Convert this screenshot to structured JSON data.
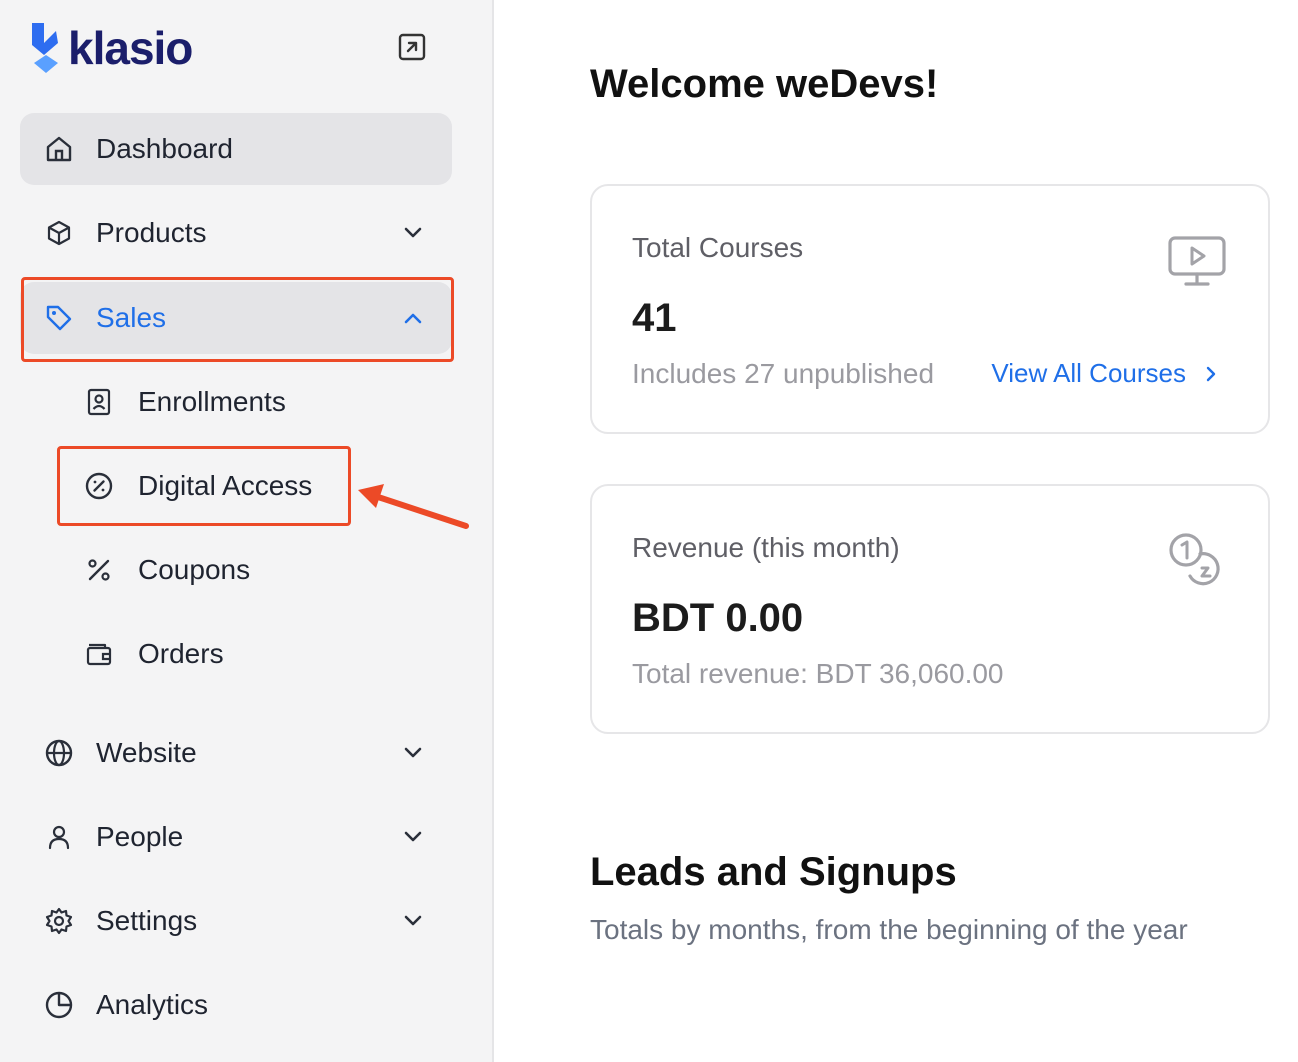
{
  "brand": {
    "name": "klasio",
    "primary": "#1b1e6b",
    "accent": "#1f6fe8",
    "logo_mark_colors": [
      "#2e6df0",
      "#5aa0ff"
    ]
  },
  "sidebar": {
    "items": [
      {
        "label": "Dashboard",
        "icon": "home-icon"
      },
      {
        "label": "Products",
        "icon": "box-icon"
      },
      {
        "label": "Sales",
        "icon": "tag-icon"
      },
      {
        "label": "Website",
        "icon": "globe-icon"
      },
      {
        "label": "People",
        "icon": "user-icon"
      },
      {
        "label": "Settings",
        "icon": "gear-icon"
      },
      {
        "label": "Analytics",
        "icon": "pie-chart-icon"
      }
    ],
    "sales_sub": [
      {
        "label": "Enrollments",
        "icon": "contact-book-icon"
      },
      {
        "label": "Digital Access",
        "icon": "percent-circle-icon"
      },
      {
        "label": "Coupons",
        "icon": "percent-icon"
      },
      {
        "label": "Orders",
        "icon": "wallet-icon"
      }
    ]
  },
  "main": {
    "welcome": "Welcome weDevs!",
    "courses_card": {
      "title": "Total Courses",
      "value": "41",
      "sub": "Includes 27 unpublished",
      "link": "View All Courses"
    },
    "revenue_card": {
      "title": "Revenue (this month)",
      "value": "BDT 0.00",
      "sub": "Total revenue: BDT 36,060.00"
    },
    "leads": {
      "title": "Leads and Signups",
      "subtitle": "Totals by months, from the beginning of the year"
    }
  },
  "annotation": {
    "highlight_color": "#ec4a27"
  }
}
